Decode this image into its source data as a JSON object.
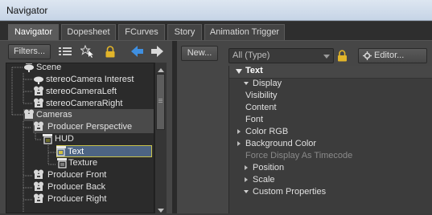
{
  "window": {
    "title": "Navigator"
  },
  "tabs": [
    {
      "label": "Navigator",
      "active": true
    },
    {
      "label": "Dopesheet",
      "active": false
    },
    {
      "label": "FCurves",
      "active": false
    },
    {
      "label": "Story",
      "active": false
    },
    {
      "label": "Animation Trigger",
      "active": false
    }
  ],
  "left_toolbar": {
    "filters_label": "Filters...",
    "icons": [
      "list-icon",
      "star-select-icon",
      "lock-icon",
      "back-arrow-icon",
      "forward-arrow-icon"
    ]
  },
  "tree": {
    "items": [
      {
        "label": "Scene"
      },
      {
        "label": "stereoCamera Interest"
      },
      {
        "label": "stereoCameraLeft"
      },
      {
        "label": "stereoCameraRight"
      },
      {
        "label": "Cameras"
      },
      {
        "label": "Producer Perspective"
      },
      {
        "label": "HUD"
      },
      {
        "label": "Text"
      },
      {
        "label": "Texture"
      },
      {
        "label": "Producer Front"
      },
      {
        "label": "Producer Back"
      },
      {
        "label": "Producer Right"
      }
    ]
  },
  "right_toolbar": {
    "new_label": "New...",
    "type_filter_value": "All (Type)",
    "editor_label": "Editor..."
  },
  "properties": {
    "header": "Text",
    "group": "Display",
    "items": [
      {
        "label": "Visibility",
        "state": "normal"
      },
      {
        "label": "Content",
        "state": "normal"
      },
      {
        "label": "Font",
        "state": "normal"
      },
      {
        "label": "Color RGB",
        "state": "collapsed"
      },
      {
        "label": "Background Color",
        "state": "collapsed"
      },
      {
        "label": "Force Display As Timecode",
        "state": "disabled"
      },
      {
        "label": "Position",
        "state": "collapsed"
      },
      {
        "label": "Scale",
        "state": "collapsed"
      },
      {
        "label": "Custom Properties",
        "state": "expanded"
      }
    ]
  },
  "colors": {
    "selection": "#4d6483",
    "selection_border": "#c9c24a",
    "accent_lock": "#e2b52a",
    "arrow_blue": "#3f8fe0"
  }
}
